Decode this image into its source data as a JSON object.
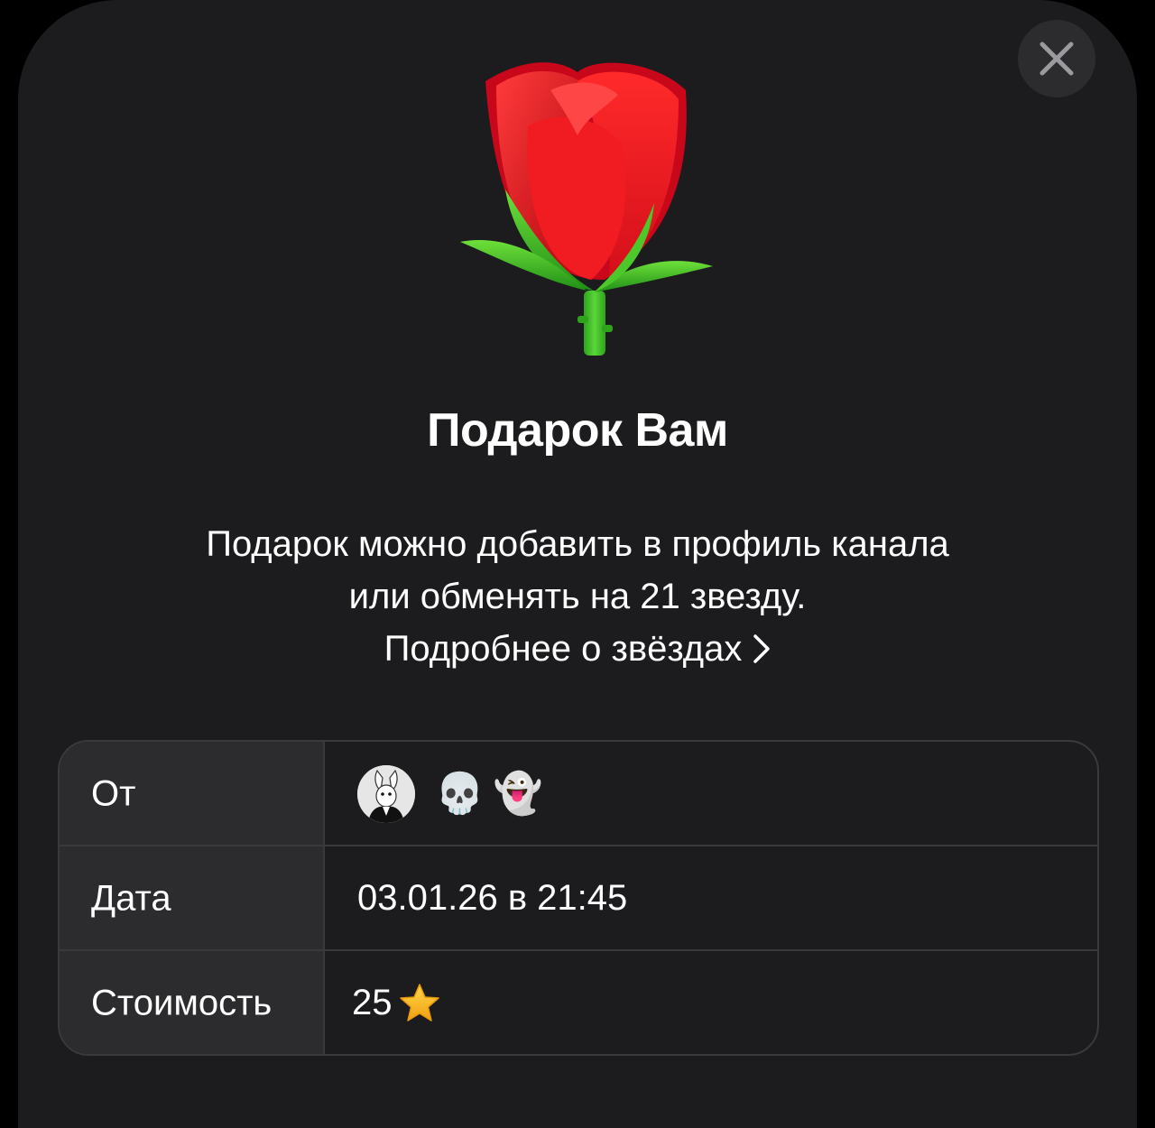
{
  "header": {
    "close_icon": "close-icon",
    "gift_icon": "rose-icon"
  },
  "title": "Подарок Вам",
  "description": {
    "line1": "Подарок можно добавить в профиль канала",
    "line2": "или обменять на 21 звезду.",
    "link_label": "Подробнее о звёздах"
  },
  "details": {
    "from": {
      "label": "От",
      "avatar_icon": "rabbit-avatar",
      "emoji_1": "💀",
      "emoji_2": "👻"
    },
    "date": {
      "label": "Дата",
      "value": "03.01.26 в 21:45"
    },
    "cost": {
      "label": "Стоимость",
      "value": "25",
      "icon": "star-icon"
    }
  },
  "colors": {
    "background": "#1c1c1e",
    "cell_label_bg": "#2c2c2e",
    "border": "#3a3a3c",
    "text": "#ffffff",
    "rose": "#e8121f",
    "leaf": "#3fbf1f",
    "star": "#f5b816"
  }
}
